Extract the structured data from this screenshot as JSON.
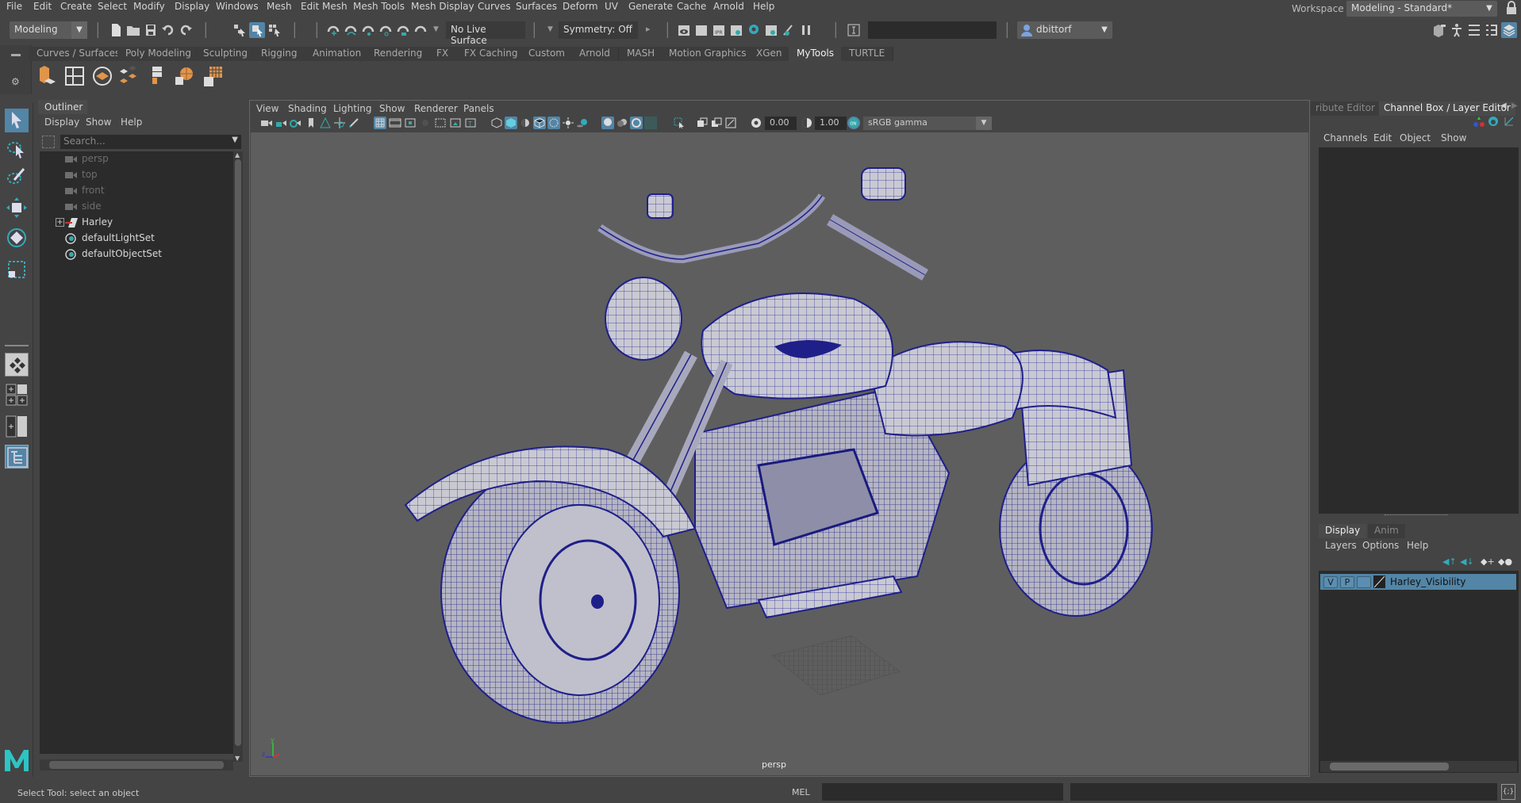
{
  "menubar": {
    "items": [
      "File",
      "Edit",
      "Create",
      "Select",
      "Modify",
      "Display",
      "Windows",
      "Mesh",
      "Edit Mesh",
      "Mesh Tools",
      "Mesh Display",
      "Curves",
      "Surfaces",
      "Deform",
      "UV",
      "Generate",
      "Cache",
      "Arnold",
      "Help"
    ],
    "workspace_label": "Workspace :",
    "workspace_value": "Modeling - Standard*"
  },
  "statusline": {
    "menuset": "Modeling",
    "live_surface": "No Live Surface",
    "symmetry": "Symmetry: Off",
    "user": "dbittorf",
    "icons": [
      "new-scene-icon",
      "open-scene-icon",
      "save-scene-icon",
      "undo-icon",
      "redo-icon",
      "select-hierarchy-icon",
      "select-object-icon",
      "select-component-icon",
      "snap-grid-icon",
      "snap-curve-icon",
      "snap-point-icon",
      "snap-projected-center-icon",
      "snap-view-plane-icon",
      "make-live-icon",
      "render-view-icon",
      "render-current-frame-icon",
      "ipr-render-icon",
      "render-settings-icon",
      "hypershade-icon",
      "render-setup-icon",
      "light-editor-icon",
      "pause-viewport-icon",
      "input-line-icon",
      "modeling-toolkit-icon",
      "human-ik-icon",
      "attribute-editor-toggle-icon",
      "tool-settings-toggle-icon",
      "channel-box-toggle-icon"
    ]
  },
  "shelf": {
    "tabs": [
      "Curves / Surfaces",
      "Poly Modeling",
      "Sculpting",
      "Rigging",
      "Animation",
      "Rendering",
      "FX",
      "FX Caching",
      "Custom",
      "Arnold",
      "MASH",
      "Motion Graphics",
      "XGen",
      "MyTools",
      "TURTLE"
    ],
    "active_tab": "MyTools",
    "icons": [
      "extrude-icon",
      "multi-cut-icon",
      "uv-layout-icon",
      "uv-shell-icon",
      "uv-unfold-icon",
      "spherical-map-icon",
      "checker-map-icon"
    ]
  },
  "toolbox": {
    "tools": [
      "select-tool-icon",
      "lasso-select-icon",
      "paint-select-icon",
      "move-tool-icon",
      "rotate-tool-icon",
      "scale-tool-icon"
    ],
    "layouts": [
      "single-perspective-layout-icon",
      "four-view-layout-icon",
      "two-pane-layout-icon",
      "outliner-persp-layout-icon"
    ]
  },
  "outliner": {
    "title": "Outliner",
    "menus": [
      "Display",
      "Show",
      "Help"
    ],
    "search_placeholder": "Search...",
    "items": [
      {
        "label": "persp",
        "type": "camera",
        "dim": true
      },
      {
        "label": "top",
        "type": "camera",
        "dim": true
      },
      {
        "label": "front",
        "type": "camera",
        "dim": true
      },
      {
        "label": "side",
        "type": "camera",
        "dim": true
      },
      {
        "label": "Harley",
        "type": "transform",
        "dim": false,
        "expandable": true
      },
      {
        "label": "defaultLightSet",
        "type": "set",
        "dim": false
      },
      {
        "label": "defaultObjectSet",
        "type": "set",
        "dim": false
      }
    ]
  },
  "viewport": {
    "menus": [
      "View",
      "Shading",
      "Lighting",
      "Show",
      "Renderer",
      "Panels"
    ],
    "exposure": "0.00",
    "gamma": "1.00",
    "color_space": "sRGB gamma",
    "camera_label": "persp",
    "axis": {
      "x": "x",
      "y": "y",
      "z": "z"
    }
  },
  "rightpanel": {
    "tabs": [
      "ribute Editor",
      "Channel Box / Layer Editor"
    ],
    "active_tab": "Channel Box / Layer Editor",
    "channel_menus": [
      "Channels",
      "Edit",
      "Object",
      "Show"
    ],
    "layer_tabs": [
      "Display",
      "Anim"
    ],
    "active_layer_tab": "Display",
    "layer_menus": [
      "Layers",
      "Options",
      "Help"
    ],
    "layers": [
      {
        "v": "V",
        "p": "P",
        "name": "Harley_Visibility",
        "selected": true
      }
    ]
  },
  "helpline": {
    "text": "Select Tool: select an object",
    "mel_label": "MEL"
  },
  "colors": {
    "accent": "#5285a6",
    "panel_bg": "#444444",
    "field_bg": "#2b2b2b",
    "viewport_bg": "#5e5e5e",
    "wire": "#1f1f8a",
    "maya_logo": "#2ec4c4"
  }
}
